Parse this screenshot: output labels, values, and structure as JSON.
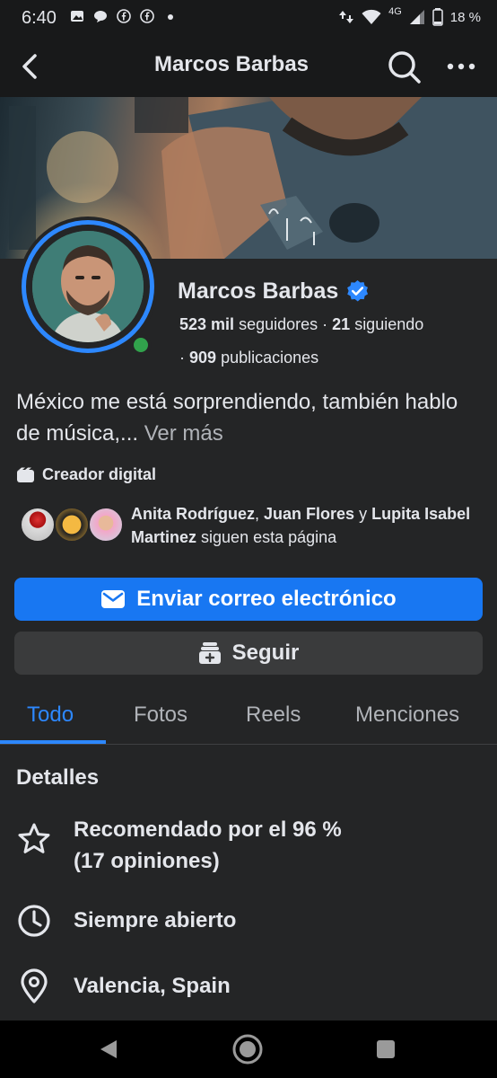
{
  "status_bar": {
    "time": "6:40",
    "network": "4G",
    "battery": "18 %"
  },
  "header": {
    "title": "Marcos Barbas"
  },
  "profile": {
    "name": "Marcos Barbas",
    "followers_count": "523 mil",
    "followers_label": "seguidores ·",
    "following_count": "21",
    "following_label": "siguiendo",
    "posts_prefix": "·",
    "posts_count": "909",
    "posts_label": "publicaciones"
  },
  "bio": {
    "text": "México me está sorprendiendo, también hablo de música,...",
    "more": "Ver más"
  },
  "category": "Creador digital",
  "mutual": {
    "name1": "Anita Rodríguez",
    "sep1": ",",
    "name2": "Juan Flores",
    "sep2": "y",
    "name3": "Lupita Isabel Martinez",
    "suffix": "siguen esta página"
  },
  "buttons": {
    "email": "Enviar correo electrónico",
    "follow": "Seguir"
  },
  "tabs": [
    "Todo",
    "Fotos",
    "Reels",
    "Menciones"
  ],
  "details": {
    "title": "Detalles",
    "recommended_line1": "Recomendado por el 96 %",
    "recommended_line2": "(17 opiniones)",
    "hours": "Siempre abierto",
    "location": "Valencia, Spain"
  },
  "icons": {
    "back": "back-arrow-icon",
    "search": "search-icon",
    "more": "more-dots-icon",
    "verified": "verified-badge-icon",
    "category": "video-creator-icon",
    "email": "envelope-icon",
    "follow": "follow-box-icon",
    "star": "star-icon",
    "clock": "clock-icon",
    "pin": "location-pin-icon"
  },
  "colors": {
    "accent": "#1877f2",
    "tab_active": "#2d88ff",
    "online": "#31a24c",
    "background": "#242526"
  }
}
